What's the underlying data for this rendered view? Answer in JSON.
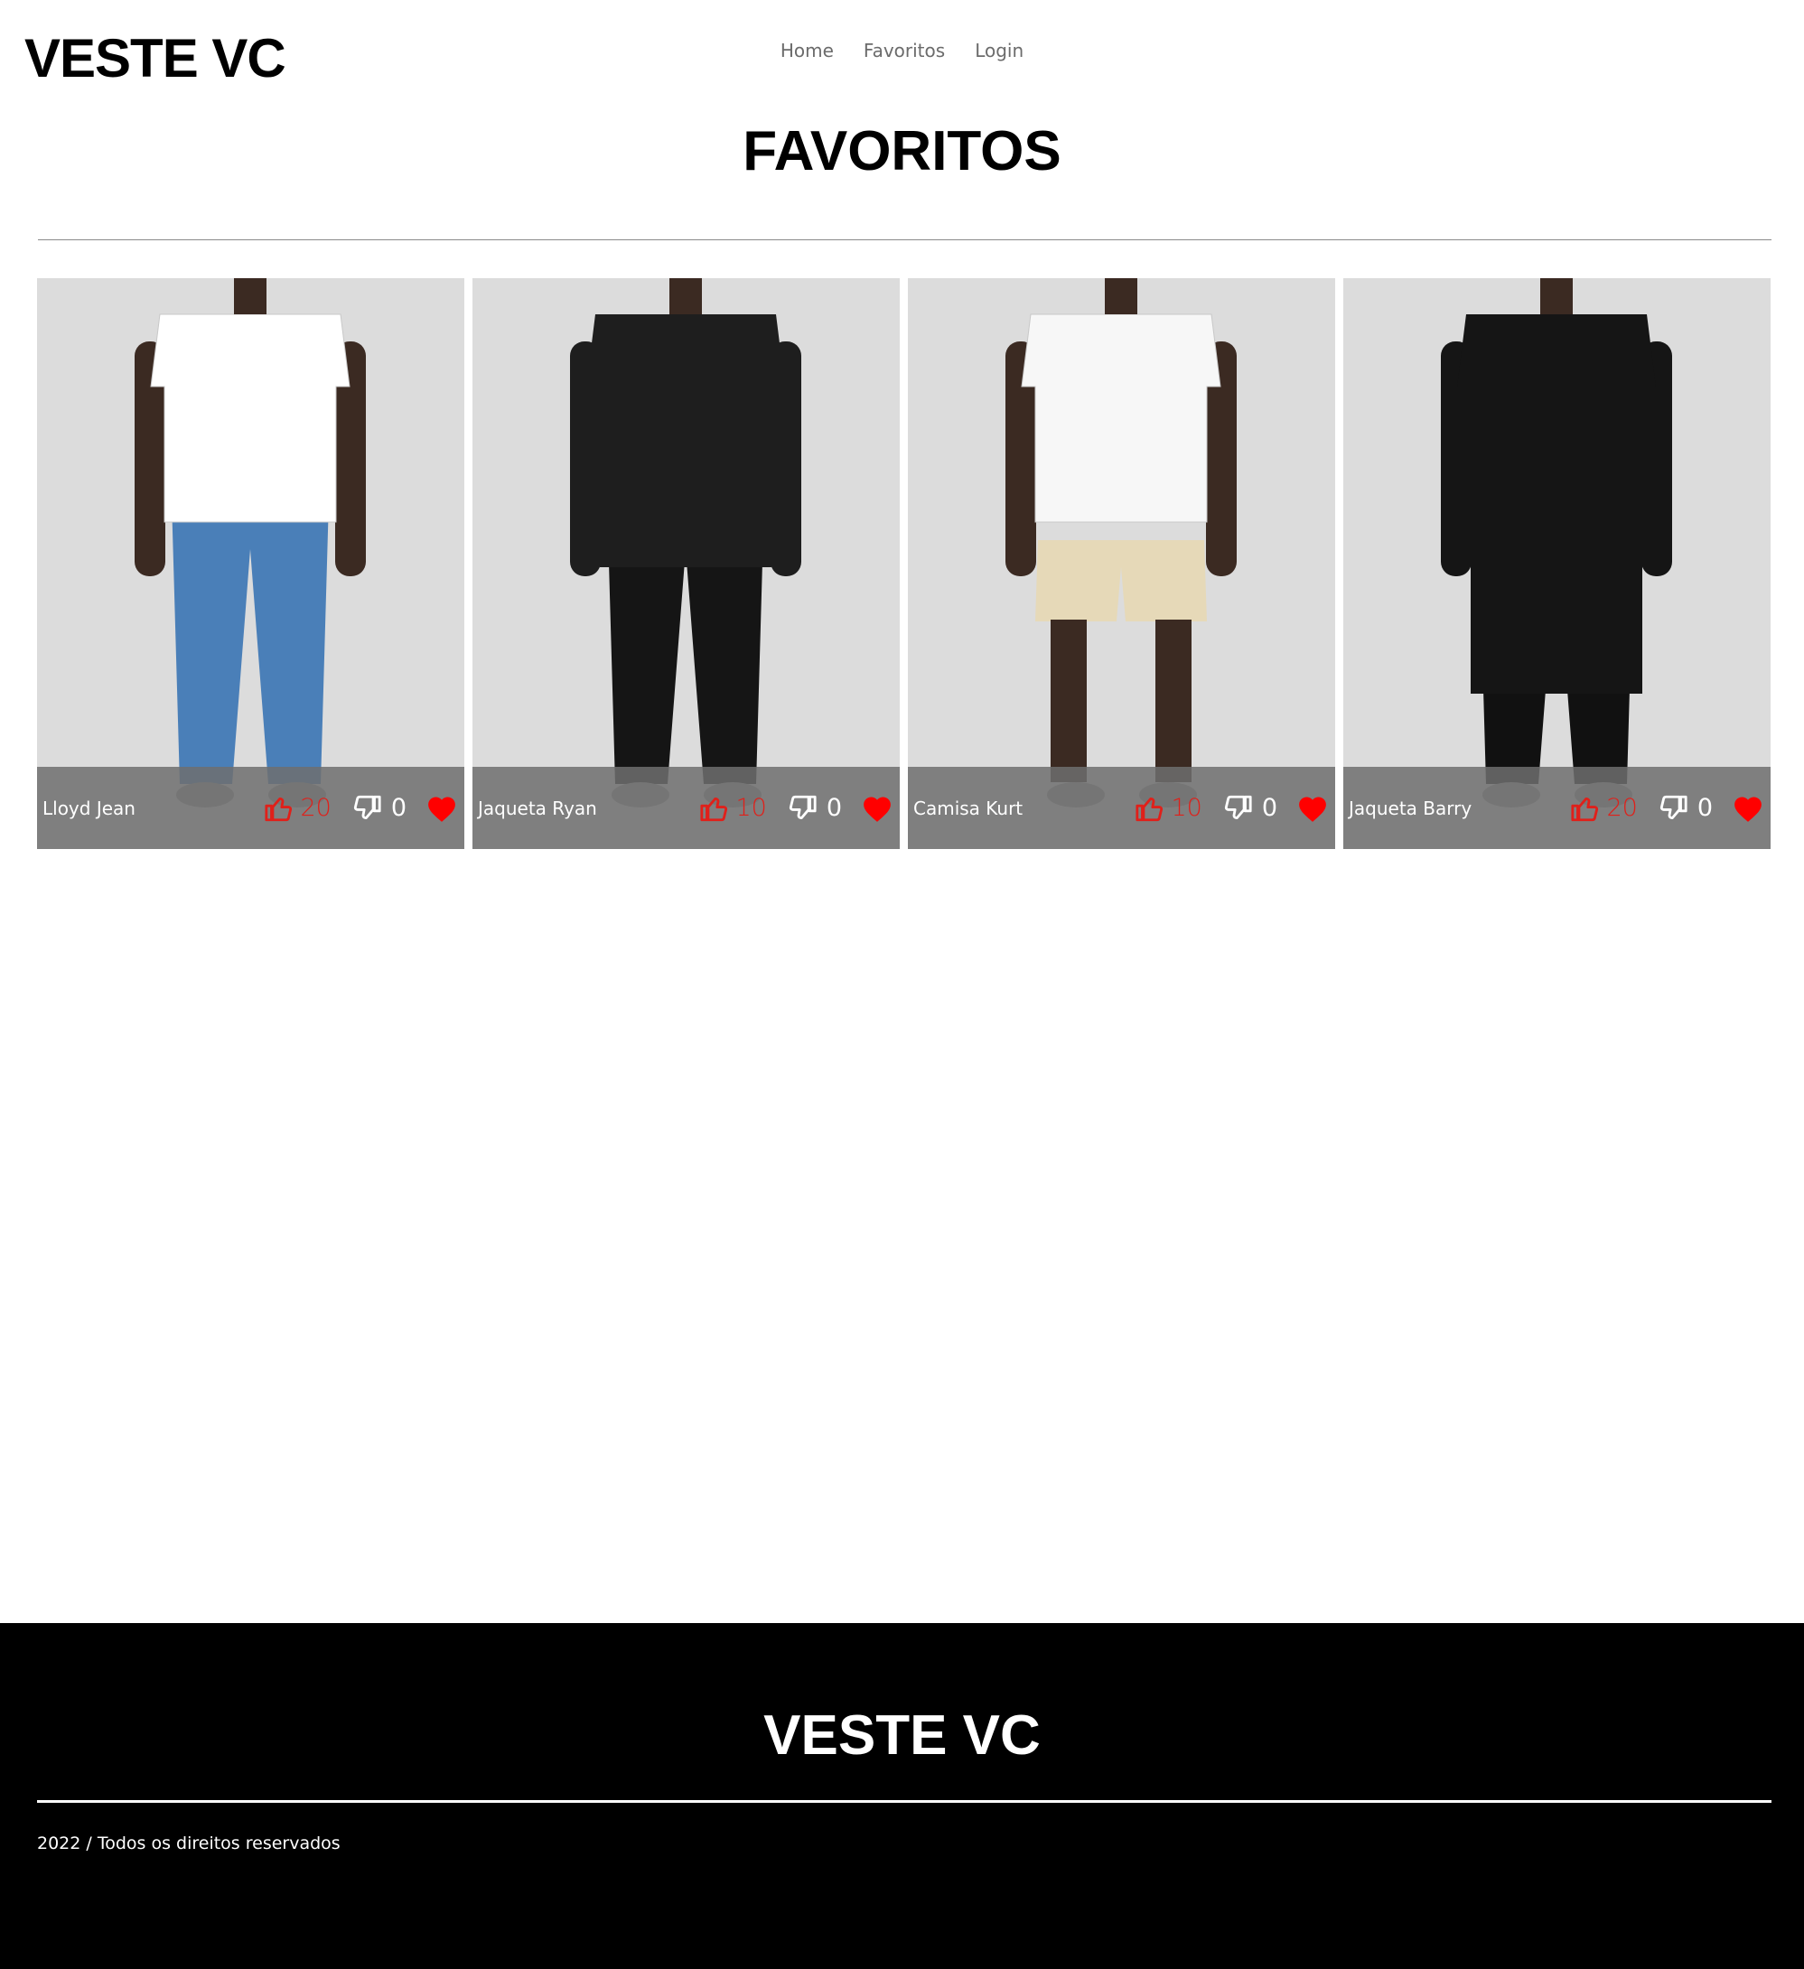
{
  "header": {
    "brand": "VESTE VC",
    "nav": [
      "Home",
      "Favoritos",
      "Login"
    ]
  },
  "page_title": "FAVORITOS",
  "products": [
    {
      "name": "Lloyd Jean",
      "likes": "20",
      "dislikes": "0",
      "favorited": true,
      "top_color": "#ffffff",
      "bottom_color": "#4a7fb8",
      "outfit": "white tee, blue jeans"
    },
    {
      "name": "Jaqueta Ryan",
      "likes": "10",
      "dislikes": "0",
      "favorited": true,
      "top_color": "#1e1e1e",
      "bottom_color": "#151515",
      "outfit": "black denim jacket, black joggers"
    },
    {
      "name": "Camisa Kurt",
      "likes": "10",
      "dislikes": "0",
      "favorited": true,
      "top_color": "#f7f7f7",
      "bottom_color": "#e6d9b8",
      "outfit": "white shirt, beige shorts"
    },
    {
      "name": "Jaqueta Barry",
      "likes": "20",
      "dislikes": "0",
      "favorited": true,
      "top_color": "#151515",
      "bottom_color": "#111111",
      "outfit": "black overshirt, black pants"
    }
  ],
  "footer": {
    "brand": "VESTE VC",
    "copyright": "2022 / Todos os direitos reservados"
  },
  "colors": {
    "like": "#e0201a",
    "heart": "#ff0000",
    "card_bg": "#dcdcdc",
    "footer_bg": "#000000"
  },
  "icons": [
    "thumbs-up-icon",
    "thumbs-down-icon",
    "heart-icon"
  ]
}
